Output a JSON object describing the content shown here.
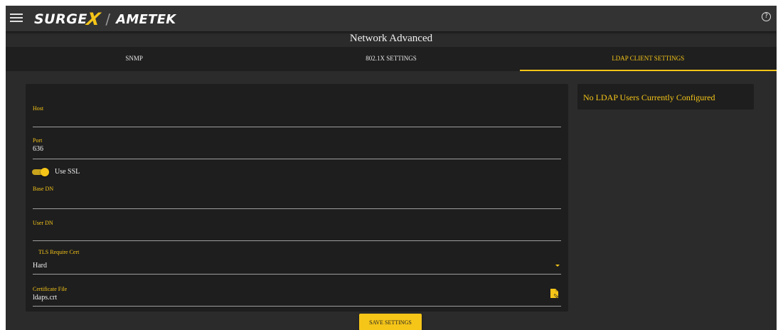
{
  "header": {
    "logo_surge": "SURGE",
    "logo_x": "X",
    "logo_slash": "/",
    "logo_ametek": "AMETEK",
    "help": "?"
  },
  "page_title": "Network Advanced",
  "tabs": [
    {
      "label": "SNMP",
      "active": false
    },
    {
      "label": "802.1X SETTINGS",
      "active": false
    },
    {
      "label": "LDAP CLIENT SETTINGS",
      "active": true
    }
  ],
  "form": {
    "host": {
      "label": "Host",
      "value": ""
    },
    "port": {
      "label": "Port",
      "value": "636"
    },
    "use_ssl": {
      "label": "Use SSL",
      "checked": true
    },
    "base_dn": {
      "label": "Base DN",
      "value": ""
    },
    "user_dn": {
      "label": "User DN",
      "value": ""
    },
    "tls_require_cert": {
      "label": "TLS Require Cert",
      "value": "Hard"
    },
    "certificate_file": {
      "label": "Certificate File",
      "value": "ldaps.crt"
    }
  },
  "users_panel": {
    "message": "No LDAP Users Currently Configured"
  },
  "save_label": "SAVE SETTINGS",
  "colors": {
    "accent": "#f5c518",
    "background": "#2b2b2b",
    "card": "#1e1e1e"
  }
}
